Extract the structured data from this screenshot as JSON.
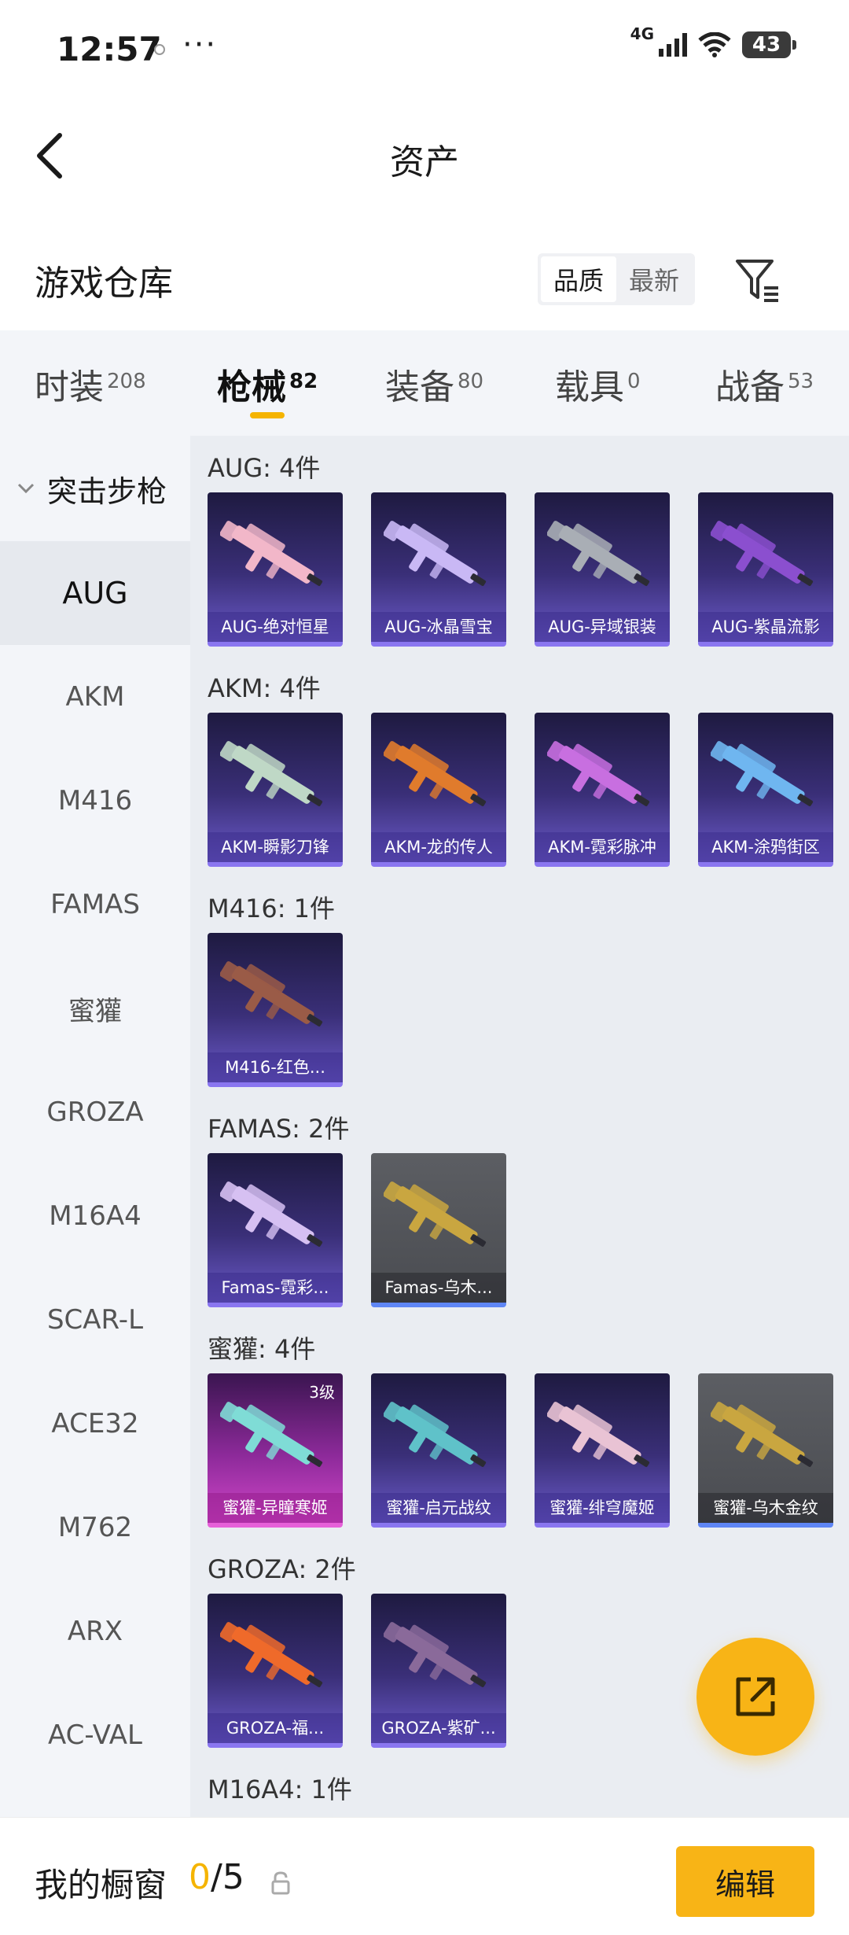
{
  "status_bar": {
    "time": "12:57",
    "dots": "···",
    "network": "4G",
    "battery": "43"
  },
  "header": {
    "title": "资产"
  },
  "warehouse": {
    "title": "游戏仓库",
    "sort_options": [
      "品质",
      "最新"
    ]
  },
  "tabs": [
    {
      "label": "时装",
      "count": "208"
    },
    {
      "label": "枪械",
      "count": "82"
    },
    {
      "label": "装备",
      "count": "80"
    },
    {
      "label": "载具",
      "count": "0"
    },
    {
      "label": "战备",
      "count": "53"
    }
  ],
  "sidebar": {
    "category": "突击步枪",
    "items": [
      "AUG",
      "AKM",
      "M416",
      "FAMAS",
      "蜜獾",
      "GROZA",
      "M16A4",
      "SCAR-L",
      "ACE32",
      "M762",
      "ARX",
      "AC-VAL"
    ]
  },
  "sections": [
    {
      "label": "AUG: 4件",
      "items": [
        {
          "name": "AUG-绝对恒星",
          "style": "purple",
          "gun_color": "#f2b7c9"
        },
        {
          "name": "AUG-冰晶雪宝",
          "style": "purple",
          "gun_color": "#c9b8f5"
        },
        {
          "name": "AUG-异域银装",
          "style": "purple",
          "gun_color": "#a9aeb5"
        },
        {
          "name": "AUG-紫晶流影",
          "style": "purple",
          "gun_color": "#8b4fcf"
        }
      ]
    },
    {
      "label": "AKM: 4件",
      "items": [
        {
          "name": "AKM-瞬影刀锋",
          "style": "purple",
          "gun_color": "#bfd8c6"
        },
        {
          "name": "AKM-龙的传人",
          "style": "purple",
          "gun_color": "#e07b2c"
        },
        {
          "name": "AKM-霓彩脉冲",
          "style": "purple",
          "gun_color": "#c86fe0"
        },
        {
          "name": "AKM-涂鸦街区",
          "style": "purple",
          "gun_color": "#6fb6f0"
        }
      ]
    },
    {
      "label": "M416: 1件",
      "items": [
        {
          "name": "M416-红色...",
          "style": "purple",
          "gun_color": "#9a5b47"
        }
      ]
    },
    {
      "label": "FAMAS: 2件",
      "items": [
        {
          "name": "Famas-霓彩...",
          "style": "purple",
          "gun_color": "#d6c0f2"
        },
        {
          "name": "Famas-乌木...",
          "style": "gray",
          "gun_color": "#c9a640"
        }
      ]
    },
    {
      "label": "蜜獾: 4件",
      "items": [
        {
          "name": "蜜獾-异瞳寒姬",
          "style": "pink",
          "gun_color": "#7fdcd6",
          "level": "3级"
        },
        {
          "name": "蜜獾-启元战纹",
          "style": "purple",
          "gun_color": "#5fc2c9"
        },
        {
          "name": "蜜獾-绯穹魔姬",
          "style": "purple",
          "gun_color": "#e9c3d4"
        },
        {
          "name": "蜜獾-乌木金纹",
          "style": "gray",
          "gun_color": "#c9a640"
        }
      ]
    },
    {
      "label": "GROZA: 2件",
      "items": [
        {
          "name": "GROZA-福...",
          "style": "purple",
          "gun_color": "#ef6a2a"
        },
        {
          "name": "GROZA-紫矿...",
          "style": "purple",
          "gun_color": "#8a6a9a"
        }
      ]
    },
    {
      "label": "M16A4: 1件",
      "items": []
    }
  ],
  "bottom_bar": {
    "label": "我的橱窗",
    "count_current": "0",
    "count_total": "/5",
    "edit_label": "编辑"
  },
  "colors": {
    "accent": "#f8b416",
    "card_purple": "#3a2f78",
    "card_gray": "#4a4c51",
    "card_pink": "#d046c8"
  },
  "icons": {
    "back": "chevron-left-icon",
    "filter": "filter-icon",
    "share": "share-external-icon",
    "lock": "lock-icon"
  }
}
